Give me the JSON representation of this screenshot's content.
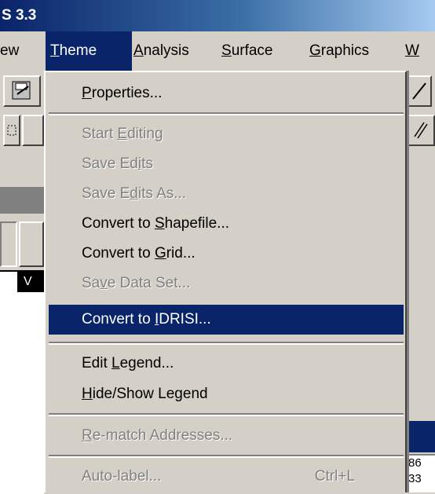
{
  "window": {
    "title_fragment": "S 3.3"
  },
  "menubar": {
    "items": [
      {
        "label": "ew",
        "name": "menu-view"
      },
      {
        "label": "Theme",
        "name": "menu-theme"
      },
      {
        "label": "Analysis",
        "name": "menu-analysis"
      },
      {
        "label": "Surface",
        "name": "menu-surface"
      },
      {
        "label": "Graphics",
        "name": "menu-graphics"
      },
      {
        "label": "W",
        "name": "menu-window"
      }
    ]
  },
  "theme_menu": {
    "properties": "Properties...",
    "start_editing": "Start Editing",
    "save_edits": "Save Edits",
    "save_edits_as": "Save Edits As...",
    "convert_shapefile": "Convert to Shapefile...",
    "convert_grid": "Convert to Grid...",
    "save_data_set": "Save Data Set...",
    "convert_idrisi": "Convert to IDRISI...",
    "edit_legend": "Edit Legend...",
    "hide_show_legend": "Hide/Show Legend",
    "rematch_addresses": "Re-match Addresses...",
    "auto_label": "Auto-label...",
    "auto_label_shortcut": "Ctrl+L"
  },
  "background": {
    "left_table_fragment": "V",
    "right_fragment_1": "86",
    "right_fragment_2": "33"
  },
  "colors": {
    "highlight": "#0a246a",
    "face": "#d4d0c8",
    "disabled": "#808080"
  }
}
